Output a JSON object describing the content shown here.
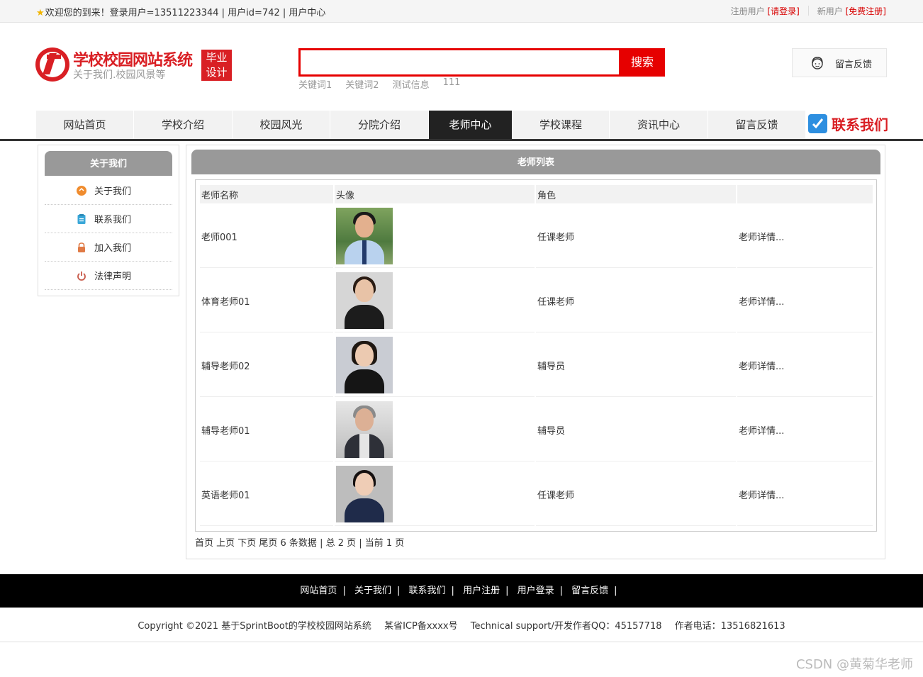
{
  "topbar": {
    "welcome": "欢迎您的到来！登录用户=13511223344 | 用户id=742 | 用户中心",
    "reg_user": "注册用户",
    "login": "[请登录]",
    "new_user": "新用户",
    "register": "[免费注册]"
  },
  "logo": {
    "title": "学校校园网站系统",
    "subtitle": "关于我们.校园风景等",
    "tag_line1": "毕业",
    "tag_line2": "设计"
  },
  "search": {
    "value": "",
    "button": "搜索",
    "keywords": [
      "关键词1",
      "关键词2",
      "测试信息",
      "111"
    ]
  },
  "feedback": {
    "label": "留言反馈"
  },
  "nav": {
    "items": [
      "网站首页",
      "学校介绍",
      "校园风光",
      "分院介绍",
      "老师中心",
      "学校课程",
      "资讯中心",
      "留言反馈"
    ],
    "active": "老师中心",
    "contact": "联系我们"
  },
  "sidebar": {
    "title": "关于我们",
    "items": [
      {
        "label": "关于我们",
        "icon": "orange-circle-icon",
        "color": "#f08c2e"
      },
      {
        "label": "联系我们",
        "icon": "clipboard-icon",
        "color": "#3aa7d8"
      },
      {
        "label": "加入我们",
        "icon": "lock-icon",
        "color": "#e07a45"
      },
      {
        "label": "法律声明",
        "icon": "power-icon",
        "color": "#c85a4a"
      }
    ]
  },
  "main": {
    "title": "老师列表",
    "columns": [
      "老师名称",
      "头像",
      "角色",
      ""
    ],
    "rows": [
      {
        "name": "老师001",
        "role": "任课老师",
        "detail": "老师详情..."
      },
      {
        "name": "体育老师01",
        "role": "任课老师",
        "detail": "老师详情..."
      },
      {
        "name": "辅导老师02",
        "role": "辅导员",
        "detail": "老师详情..."
      },
      {
        "name": "辅导老师01",
        "role": "辅导员",
        "detail": "老师详情..."
      },
      {
        "name": "英语老师01",
        "role": "任课老师",
        "detail": "老师详情..."
      }
    ],
    "pager": "首页 上页 下页 尾页 6 条数据 | 总 2 页 | 当前 1 页"
  },
  "footer": {
    "links": [
      "网站首页",
      "关于我们",
      "联系我们",
      "用户注册",
      "用户登录",
      "留言反馈"
    ],
    "copyright": "Copyright ©2021 基于SprintBoot的学校校园网站系统",
    "icp": "某省ICP备xxxx号",
    "support": "Technical support/开发作者QQ：45157718",
    "phone": "作者电话：13516821613"
  },
  "watermark": "CSDN @黄菊华老师"
}
